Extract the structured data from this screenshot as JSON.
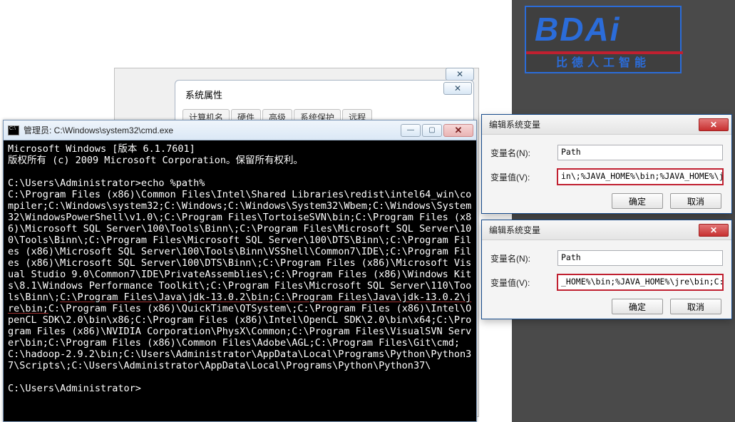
{
  "banner": {
    "logo": "BDAi",
    "cn": "比德人工智能"
  },
  "sysprop": {
    "title": "系统属性",
    "tabs": [
      "计算机名",
      "硬件",
      "高级",
      "系统保护",
      "远程"
    ]
  },
  "cmd": {
    "title": "管理员: C:\\Windows\\system32\\cmd.exe",
    "line_version": "Microsoft Windows [版本 6.1.7601]",
    "line_copyright": "版权所有 (c) 2009 Microsoft Corporation。保留所有权利。",
    "prompt1": "C:\\Users\\Administrator>echo %path%",
    "path_pre": "C:\\Program Files (x86)\\Common Files\\Intel\\Shared Libraries\\redist\\intel64_win\\compiler;C:\\Windows\\system32;C:\\Windows;C:\\Windows\\System32\\Wbem;C:\\Windows\\System32\\WindowsPowerShell\\v1.0\\;C:\\Program Files\\TortoiseSVN\\bin;C:\\Program Files (x86)\\Microsoft SQL Server\\100\\Tools\\Binn\\;C:\\Program Files\\Microsoft SQL Server\\100\\Tools\\Binn\\;C:\\Program Files\\Microsoft SQL Server\\100\\DTS\\Binn\\;C:\\Program Files (x86)\\Microsoft SQL Server\\100\\Tools\\Binn\\VSShell\\Common7\\IDE\\;C:\\Program Files (x86)\\Microsoft SQL Server\\100\\DTS\\Binn\\;C:\\Program Files (x86)\\Microsoft Visual Studio 9.0\\Common7\\IDE\\PrivateAssemblies\\;C:\\Program Files (x86)\\Windows Kits\\8.1\\Windows Performance Toolkit\\;C:\\Program Files\\Microsoft SQL Server\\110\\Tools\\Binn\\;",
    "path_hl": "C:\\Program Files\\Java\\jdk-13.0.2\\bin;C:\\Program Files\\Java\\jdk-13.0.2\\jre\\bin;",
    "path_post": "C:\\Program Files (x86)\\QuickTime\\QTSystem\\;C:\\Program Files (x86)\\Intel\\OpenCL SDK\\2.0\\bin\\x86;C:\\Program Files (x86)\\Intel\\OpenCL SDK\\2.0\\bin\\x64;C:\\Program Files (x86)\\NVIDIA Corporation\\PhysX\\Common;C:\\Program Files\\VisualSVN Server\\bin;C:\\Program Files (x86)\\Common Files\\Adobe\\AGL;C:\\Program Files\\Git\\cmd;C:\\hadoop-2.9.2\\bin;C:\\Users\\Administrator\\AppData\\Local\\Programs\\Python\\Python37\\Scripts\\;C:\\Users\\Administrator\\AppData\\Local\\Programs\\Python\\Python37\\",
    "prompt2": "C:\\Users\\Administrator>"
  },
  "env1": {
    "title": "编辑系统变量",
    "name_label": "变量名(N):",
    "value_label": "变量值(V):",
    "name": "Path",
    "value": "in\\;%JAVA_HOME%\\bin;%JAVA_HOME%\\jre\\",
    "ok": "确定",
    "cancel": "取消"
  },
  "env2": {
    "title": "编辑系统变量",
    "name_label": "变量名(N):",
    "value_label": "变量值(V):",
    "name": "Path",
    "value": "_HOME%\\bin;%JAVA_HOME%\\jre\\bin;C:\\Pr",
    "ok": "确定",
    "cancel": "取消"
  }
}
